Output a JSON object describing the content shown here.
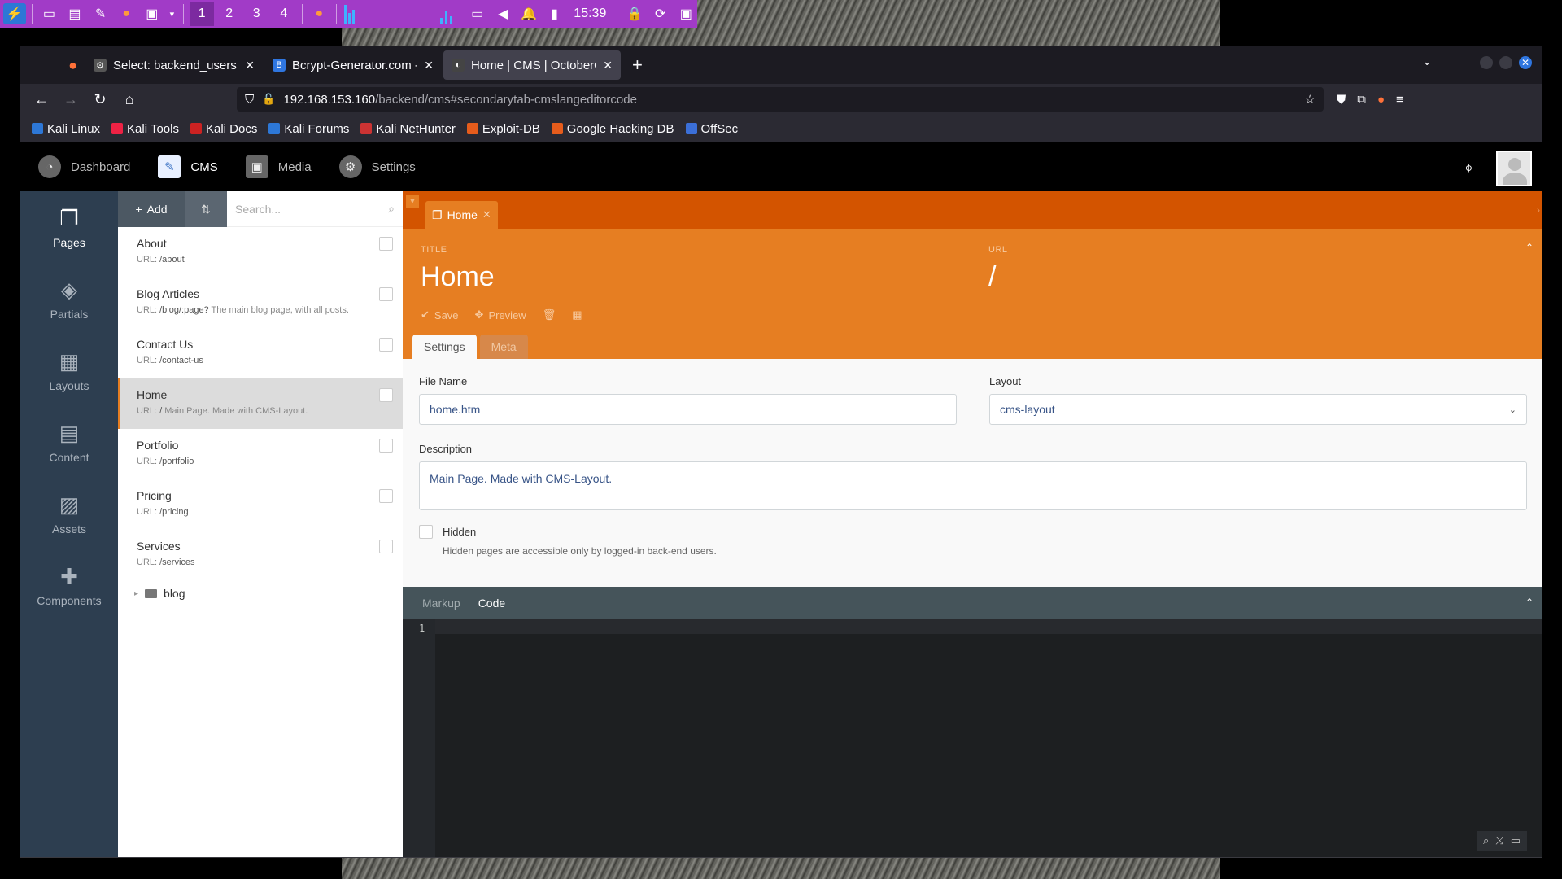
{
  "taskbar": {
    "workspaces": [
      "1",
      "2",
      "3",
      "4"
    ],
    "clock": "15:39"
  },
  "browser": {
    "tabs": [
      {
        "title": "Select: backend_users - A",
        "favicon_color": "#555"
      },
      {
        "title": "Bcrypt-Generator.com - C",
        "favicon_color": "#2f76e0",
        "favicon_letter": "B"
      },
      {
        "title": "Home | CMS | OctoberCM",
        "favicon_color": "#444"
      }
    ],
    "url_host": "192.168.153.160",
    "url_path": "/backend/cms#secondarytab-cmslangeditorcode",
    "bookmarks": [
      "Kali Linux",
      "Kali Tools",
      "Kali Docs",
      "Kali Forums",
      "Kali NetHunter",
      "Exploit-DB",
      "Google Hacking DB",
      "OffSec"
    ]
  },
  "cms": {
    "topnav": [
      {
        "label": "Dashboard",
        "icon": "dashboard-icon"
      },
      {
        "label": "CMS",
        "icon": "cms-icon",
        "active": true
      },
      {
        "label": "Media",
        "icon": "media-icon"
      },
      {
        "label": "Settings",
        "icon": "settings-icon"
      }
    ],
    "sidebar": [
      {
        "label": "Pages",
        "icon": "pages-icon"
      },
      {
        "label": "Partials",
        "icon": "partials-icon"
      },
      {
        "label": "Layouts",
        "icon": "layouts-icon"
      },
      {
        "label": "Content",
        "icon": "content-icon"
      },
      {
        "label": "Assets",
        "icon": "assets-icon"
      },
      {
        "label": "Components",
        "icon": "components-icon"
      }
    ],
    "pagelist": {
      "add_label": "Add",
      "search_placeholder": "Search...",
      "items": [
        {
          "title": "About",
          "url_prefix": "URL: ",
          "url": "/about",
          "desc": ""
        },
        {
          "title": "Blog Articles",
          "url_prefix": "URL: ",
          "url": "/blog/:page?",
          "desc": " The main blog page, with all posts."
        },
        {
          "title": "Contact Us",
          "url_prefix": "URL: ",
          "url": "/contact-us",
          "desc": ""
        },
        {
          "title": "Home",
          "url_prefix": "URL: ",
          "url": "/",
          "desc": " Main Page. Made with CMS-Layout."
        },
        {
          "title": "Portfolio",
          "url_prefix": "URL: ",
          "url": "/portfolio",
          "desc": ""
        },
        {
          "title": "Pricing",
          "url_prefix": "URL: ",
          "url": "/pricing",
          "desc": ""
        },
        {
          "title": "Services",
          "url_prefix": "URL: ",
          "url": "/services",
          "desc": ""
        }
      ],
      "folder": "blog"
    },
    "editor": {
      "tab_label": "Home",
      "title_label": "TITLE",
      "title_value": "Home",
      "url_label": "URL",
      "url_value": "/",
      "save_label": "Save",
      "preview_label": "Preview",
      "subtabs": [
        "Settings",
        "Meta"
      ],
      "file_name_label": "File Name",
      "file_name_value": "home.htm",
      "layout_label": "Layout",
      "layout_value": "cms-layout",
      "description_label": "Description",
      "description_value": "Main Page. Made with CMS-Layout.",
      "hidden_label": "Hidden",
      "hidden_help": "Hidden pages are accessible only by logged-in back-end users.",
      "code_tabs": [
        "Markup",
        "Code"
      ],
      "line_number": "1"
    }
  },
  "colors": {
    "accent_orange": "#e67e22",
    "tabbar_orange": "#d35400",
    "sidebar_bg": "#2d3e50",
    "taskbar_purple": "#a13bc7"
  }
}
